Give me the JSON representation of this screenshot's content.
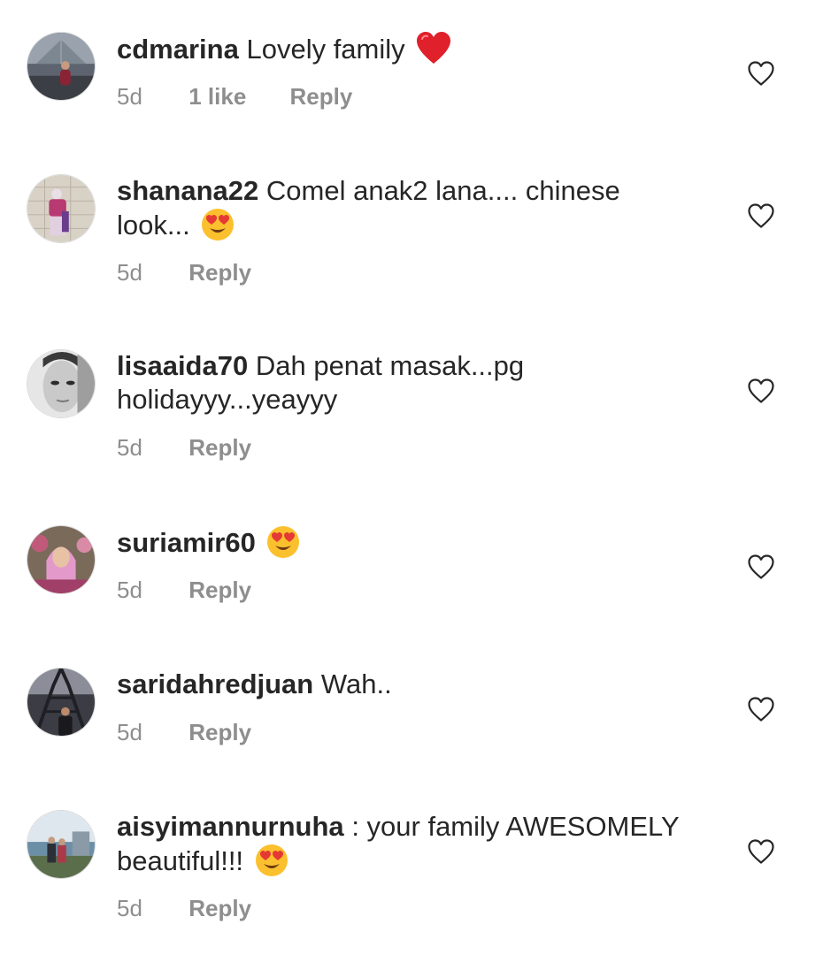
{
  "comments": [
    {
      "username": "cdmarina",
      "text": "Lovely family",
      "emoji": "heart",
      "time": "5d",
      "likes": "1 like",
      "reply": "Reply"
    },
    {
      "username": "shanana22",
      "text": "Comel anak2 lana.... chinese look...",
      "emoji": "heart-eyes",
      "time": "5d",
      "likes": "",
      "reply": "Reply"
    },
    {
      "username": "lisaaida70",
      "text": "Dah penat masak...pg holidayyy...yeayyy",
      "emoji": "",
      "time": "5d",
      "likes": "",
      "reply": "Reply"
    },
    {
      "username": "suriamir60",
      "text": "",
      "emoji": "heart-eyes",
      "time": "5d",
      "likes": "",
      "reply": "Reply"
    },
    {
      "username": "saridahredjuan",
      "text": "Wah..",
      "emoji": "",
      "time": "5d",
      "likes": "",
      "reply": "Reply"
    },
    {
      "username": "aisyimannurnuha",
      "text": ": your family AWESOMELY beautiful!!!",
      "emoji": "heart-eyes",
      "time": "5d",
      "likes": "",
      "reply": "Reply"
    }
  ],
  "icons": {
    "like": "heart-outline-icon"
  },
  "colors": {
    "text": "#262626",
    "meta": "#8e8e8e",
    "heart_emoji": "#e0202b",
    "emoji_face": "#fbc02d"
  }
}
